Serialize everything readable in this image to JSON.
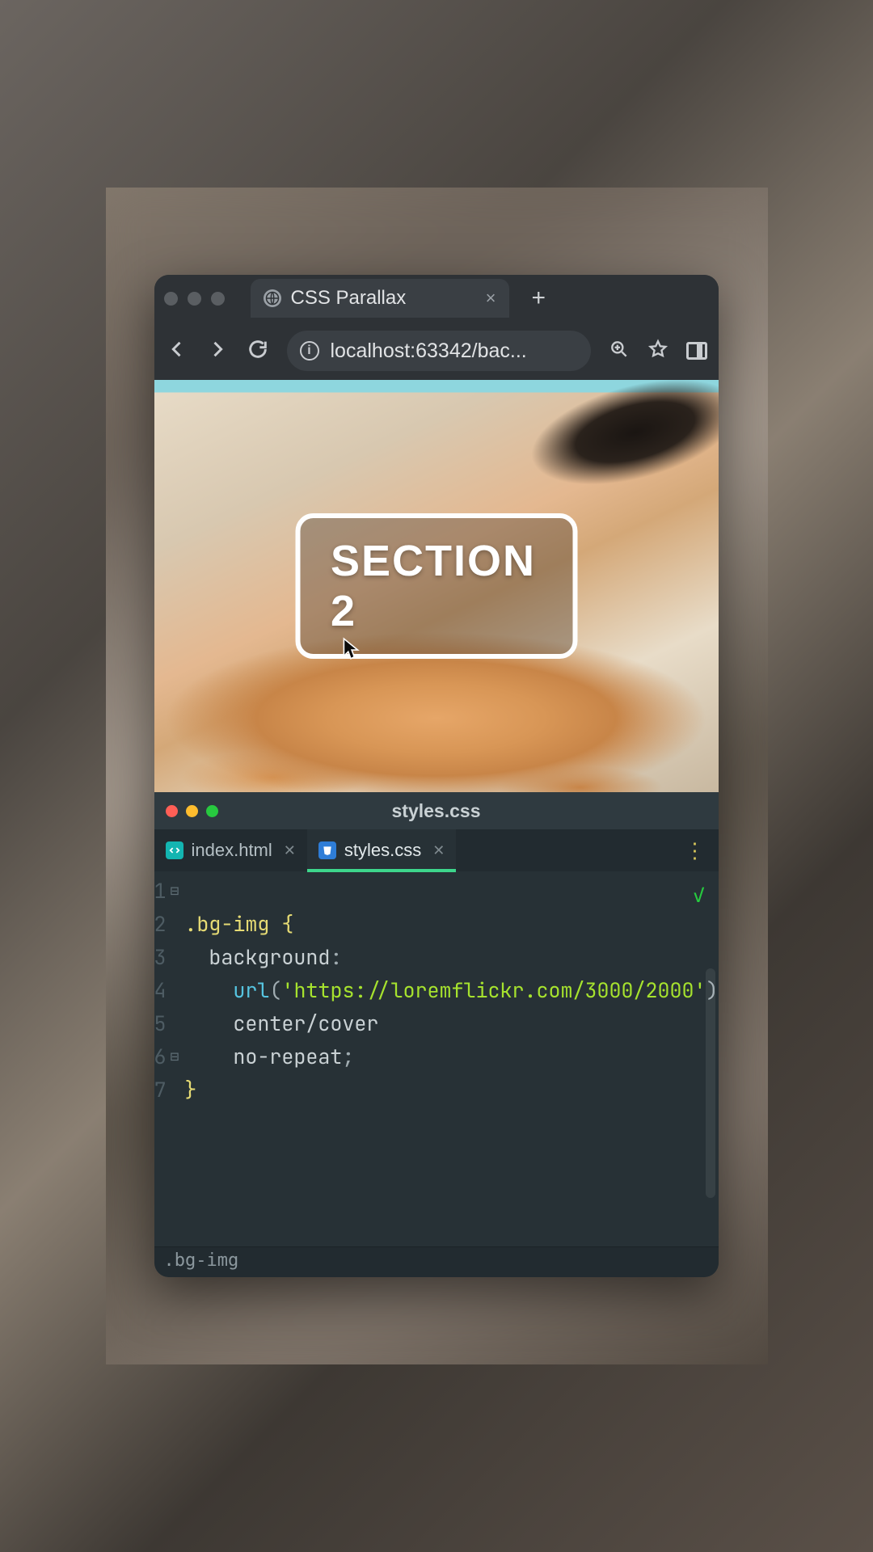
{
  "browser": {
    "tab_title": "CSS Parallax",
    "url_display": "localhost:63342/bac...",
    "new_tab_glyph": "+",
    "close_glyph": "×"
  },
  "page": {
    "section_label": "SECTION 2"
  },
  "editor": {
    "window_title": "styles.css",
    "tabs": [
      {
        "name": "index.html",
        "kind": "html",
        "active": false
      },
      {
        "name": "styles.css",
        "kind": "css",
        "active": true
      }
    ],
    "breadcrumb": ".bg-img",
    "line_numbers": [
      "1",
      "2",
      "3",
      "4",
      "5",
      "6",
      "7"
    ],
    "code": {
      "l1_selector": ".bg-img",
      "l1_brace_open": " {",
      "l2_prop": "background",
      "l2_colon": ":",
      "l3_func": "url",
      "l3_paren_open": "(",
      "l3_q1": "'",
      "l3_url": "https://loremflickr.com/3000/2000",
      "l3_q2": "'",
      "l3_paren_close": ")",
      "l4_val": "center/cover",
      "l5_val": "no-repeat",
      "l5_semicolon": ";",
      "l6_brace_close": "}"
    }
  }
}
